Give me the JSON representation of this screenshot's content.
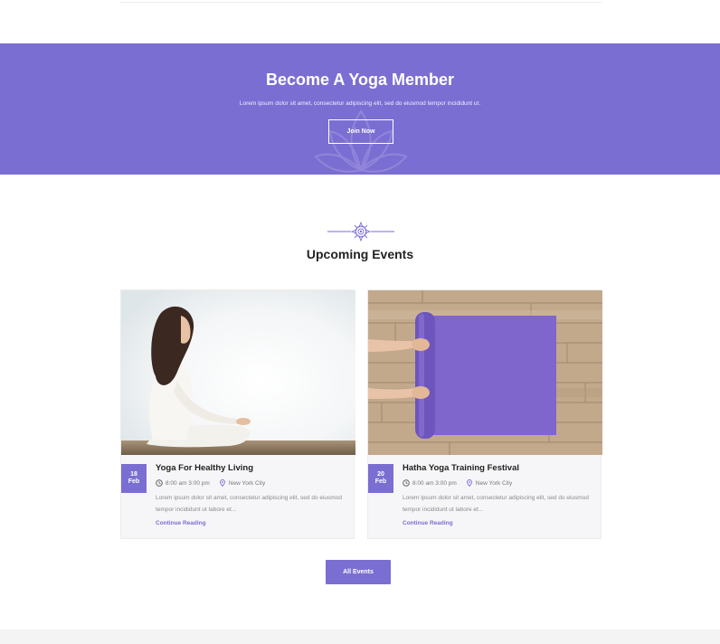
{
  "colors": {
    "accent": "#7b6ed2",
    "card_bg": "#f6f6f8",
    "text_dark": "#222222",
    "text_muted": "#8a8a8a"
  },
  "banner": {
    "title": "Become A Yoga Member",
    "subtitle": "Lorem ipsum dolor sit amet, consectetur adipiscing elit, sed do eiusmod tempor incididunt ut.",
    "button_label": "Join Now",
    "background_icon": "lotus-icon"
  },
  "events": {
    "section_icon": "mandala-icon",
    "title": "Upcoming Events",
    "cards": [
      {
        "image_icon": "woman-meditating-photo",
        "day": "18",
        "month": "Feb",
        "title": "Yoga For Healthy Living",
        "time": "8:00 am 3:00 pm",
        "location": "New York City",
        "excerpt": "Lorem ipsum dolor sit amet, consectetur adipiscing elit, sed do eiusmod tempor incididunt ut labore et...",
        "link": "Continue Reading"
      },
      {
        "image_icon": "yoga-mat-photo",
        "day": "20",
        "month": "Feb",
        "title": "Hatha Yoga Training Festival",
        "time": "8:00 am 3:00 pm",
        "location": "New York City",
        "excerpt": "Lorem ipsum dolor sit amet, consectetur adipiscing elit, sed do eiusmod tempor incididunt ut labore et...",
        "link": "Continue Reading"
      }
    ],
    "button_label": "All Events"
  }
}
